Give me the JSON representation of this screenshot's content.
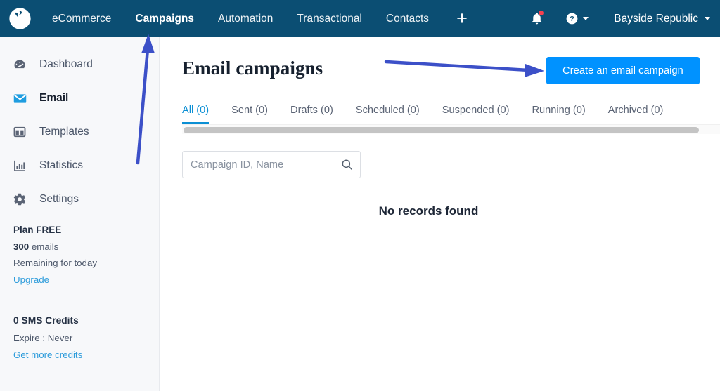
{
  "topnav": {
    "logo_icon": "sendinblue-pinwheel-logo",
    "links": [
      {
        "label": "eCommerce",
        "active": false
      },
      {
        "label": "Campaigns",
        "active": true
      },
      {
        "label": "Automation",
        "active": false
      },
      {
        "label": "Transactional",
        "active": false
      },
      {
        "label": "Contacts",
        "active": false
      }
    ],
    "add_label": "+",
    "notifications_icon": "bell-icon",
    "help_icon": "help-circle-icon",
    "account_label": "Bayside Republic"
  },
  "sidebar": {
    "items": [
      {
        "label": "Dashboard",
        "icon": "speedometer-icon",
        "active": false
      },
      {
        "label": "Email",
        "icon": "envelope-icon",
        "active": true
      },
      {
        "label": "Templates",
        "icon": "layout-icon",
        "active": false
      },
      {
        "label": "Statistics",
        "icon": "bar-chart-icon",
        "active": false
      },
      {
        "label": "Settings",
        "icon": "gear-icon",
        "active": false
      }
    ],
    "plan": {
      "title": "Plan FREE",
      "emails_count": "300",
      "emails_word": "emails",
      "remaining_text": "Remaining for today",
      "upgrade_link": "Upgrade"
    },
    "sms": {
      "title": "0 SMS Credits",
      "expire_text": "Expire : Never",
      "credits_link": "Get more credits"
    }
  },
  "main": {
    "page_title": "Email campaigns",
    "create_button": "Create an email campaign",
    "tabs": [
      {
        "label": "All (0)",
        "active": true
      },
      {
        "label": "Sent (0)",
        "active": false
      },
      {
        "label": "Drafts (0)",
        "active": false
      },
      {
        "label": "Scheduled (0)",
        "active": false
      },
      {
        "label": "Suspended (0)",
        "active": false
      },
      {
        "label": "Running (0)",
        "active": false
      },
      {
        "label": "Archived (0)",
        "active": false
      }
    ],
    "search_placeholder": "Campaign ID, Name",
    "search_value": "",
    "search_icon": "search-icon",
    "empty_state": "No records found"
  },
  "annotations": {
    "arrow_color": "#3c50c8",
    "arrows": [
      {
        "name": "arrow-to-campaigns-tab",
        "direction": "up"
      },
      {
        "name": "arrow-to-create-button",
        "direction": "right"
      }
    ]
  },
  "colors": {
    "topbar": "#0b4e73",
    "sidebar": "#f7f8fa",
    "accent_blue": "#0092ff",
    "tab_active": "#0b8fd4",
    "link": "#2d9cdb",
    "notification_dot": "#f5414f"
  }
}
